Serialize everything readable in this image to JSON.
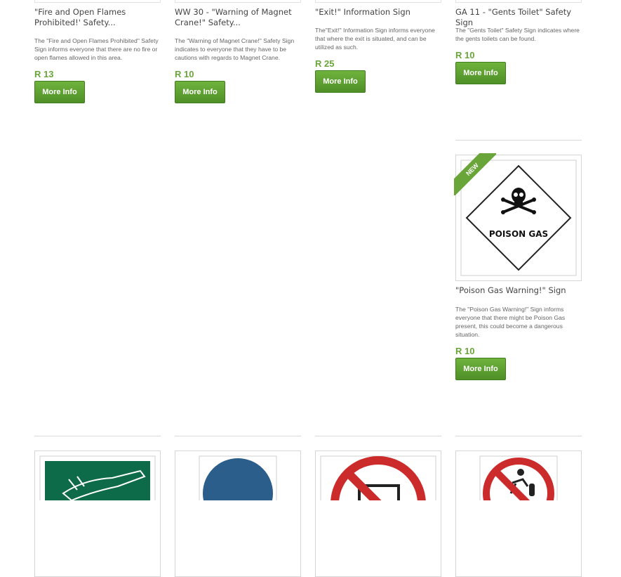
{
  "products_row1": [
    {
      "title": "\"Fire and Open Flames Prohibited!' Safety...",
      "description": "The \"Fire and Open Flames Prohibited\" Safety Sign informs everyone that there are no fire or open flames allowed in this area.",
      "price": "R 13",
      "button": "More Info"
    },
    {
      "title": "WW 30 - \"Warning of Magnet Crane!\" Safety...",
      "description": "The \"Warning of Magnet Crane!\" Safety Sign indicates to everyone that they have to be cautions with regards to Magnet Crane.",
      "price": "R 10",
      "button": "More Info"
    },
    {
      "title": "\"Exit!\" Information Sign",
      "description": "The\"Exit!\" Information Sign informs everyone that where the exit is situated, and can be utilized as such.",
      "price": "R 25",
      "button": "More Info"
    },
    {
      "title": "GA 11 - \"Gents Toilet\" Safety Sign",
      "description": "The \"Gents Toilet\" Safety Sign indicates where the gents toilets can be found.",
      "price": "R 10",
      "button": "More Info"
    }
  ],
  "featured": {
    "badge": "NEW",
    "sign_text": "POISON GAS",
    "title": "\"Poison Gas Warning!\" Sign",
    "description": "The \"Poison Gas Warning!\" Sign informs everyone that there might be Poison Gas present, this could become a dangerous situation.",
    "price": "R 10",
    "button": "More Info"
  },
  "colors": {
    "accent_green": "#6aa539",
    "sign_green": "#0e6b4a",
    "sign_blue": "#2b5e8a",
    "sign_red": "#cc2b2b"
  },
  "bottom_row_icons": [
    "grinder-sign-icon",
    "mandatory-blue-sign-icon",
    "prohibition-sign-icon",
    "no-gas-cylinder-sign-icon"
  ]
}
